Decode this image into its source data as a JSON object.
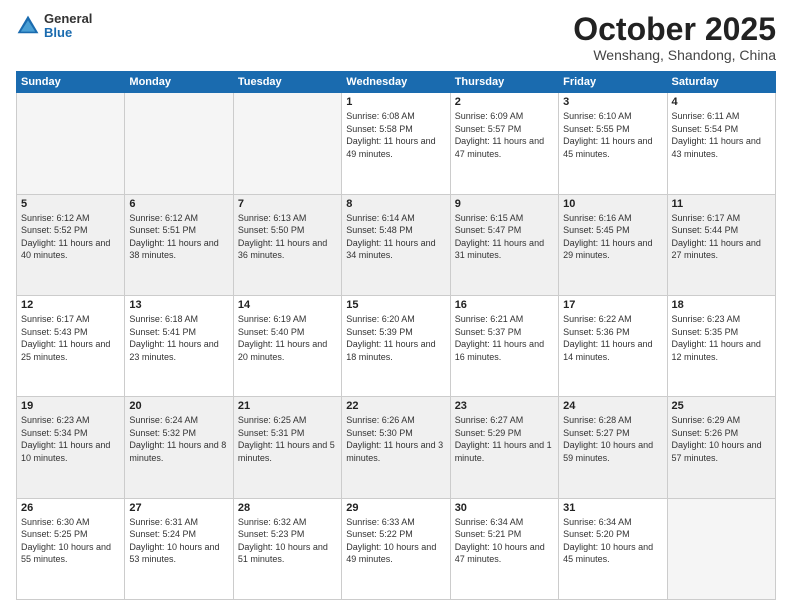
{
  "logo": {
    "general": "General",
    "blue": "Blue"
  },
  "header": {
    "month": "October 2025",
    "location": "Wenshang, Shandong, China"
  },
  "weekdays": [
    "Sunday",
    "Monday",
    "Tuesday",
    "Wednesday",
    "Thursday",
    "Friday",
    "Saturday"
  ],
  "weeks": [
    [
      {
        "day": "",
        "empty": true
      },
      {
        "day": "",
        "empty": true
      },
      {
        "day": "",
        "empty": true
      },
      {
        "day": "1",
        "sunrise": "6:08 AM",
        "sunset": "5:58 PM",
        "daylight": "11 hours and 49 minutes."
      },
      {
        "day": "2",
        "sunrise": "6:09 AM",
        "sunset": "5:57 PM",
        "daylight": "11 hours and 47 minutes."
      },
      {
        "day": "3",
        "sunrise": "6:10 AM",
        "sunset": "5:55 PM",
        "daylight": "11 hours and 45 minutes."
      },
      {
        "day": "4",
        "sunrise": "6:11 AM",
        "sunset": "5:54 PM",
        "daylight": "11 hours and 43 minutes."
      }
    ],
    [
      {
        "day": "5",
        "sunrise": "6:12 AM",
        "sunset": "5:52 PM",
        "daylight": "11 hours and 40 minutes."
      },
      {
        "day": "6",
        "sunrise": "6:12 AM",
        "sunset": "5:51 PM",
        "daylight": "11 hours and 38 minutes."
      },
      {
        "day": "7",
        "sunrise": "6:13 AM",
        "sunset": "5:50 PM",
        "daylight": "11 hours and 36 minutes."
      },
      {
        "day": "8",
        "sunrise": "6:14 AM",
        "sunset": "5:48 PM",
        "daylight": "11 hours and 34 minutes."
      },
      {
        "day": "9",
        "sunrise": "6:15 AM",
        "sunset": "5:47 PM",
        "daylight": "11 hours and 31 minutes."
      },
      {
        "day": "10",
        "sunrise": "6:16 AM",
        "sunset": "5:45 PM",
        "daylight": "11 hours and 29 minutes."
      },
      {
        "day": "11",
        "sunrise": "6:17 AM",
        "sunset": "5:44 PM",
        "daylight": "11 hours and 27 minutes."
      }
    ],
    [
      {
        "day": "12",
        "sunrise": "6:17 AM",
        "sunset": "5:43 PM",
        "daylight": "11 hours and 25 minutes."
      },
      {
        "day": "13",
        "sunrise": "6:18 AM",
        "sunset": "5:41 PM",
        "daylight": "11 hours and 23 minutes."
      },
      {
        "day": "14",
        "sunrise": "6:19 AM",
        "sunset": "5:40 PM",
        "daylight": "11 hours and 20 minutes."
      },
      {
        "day": "15",
        "sunrise": "6:20 AM",
        "sunset": "5:39 PM",
        "daylight": "11 hours and 18 minutes."
      },
      {
        "day": "16",
        "sunrise": "6:21 AM",
        "sunset": "5:37 PM",
        "daylight": "11 hours and 16 minutes."
      },
      {
        "day": "17",
        "sunrise": "6:22 AM",
        "sunset": "5:36 PM",
        "daylight": "11 hours and 14 minutes."
      },
      {
        "day": "18",
        "sunrise": "6:23 AM",
        "sunset": "5:35 PM",
        "daylight": "11 hours and 12 minutes."
      }
    ],
    [
      {
        "day": "19",
        "sunrise": "6:23 AM",
        "sunset": "5:34 PM",
        "daylight": "11 hours and 10 minutes."
      },
      {
        "day": "20",
        "sunrise": "6:24 AM",
        "sunset": "5:32 PM",
        "daylight": "11 hours and 8 minutes."
      },
      {
        "day": "21",
        "sunrise": "6:25 AM",
        "sunset": "5:31 PM",
        "daylight": "11 hours and 5 minutes."
      },
      {
        "day": "22",
        "sunrise": "6:26 AM",
        "sunset": "5:30 PM",
        "daylight": "11 hours and 3 minutes."
      },
      {
        "day": "23",
        "sunrise": "6:27 AM",
        "sunset": "5:29 PM",
        "daylight": "11 hours and 1 minute."
      },
      {
        "day": "24",
        "sunrise": "6:28 AM",
        "sunset": "5:27 PM",
        "daylight": "10 hours and 59 minutes."
      },
      {
        "day": "25",
        "sunrise": "6:29 AM",
        "sunset": "5:26 PM",
        "daylight": "10 hours and 57 minutes."
      }
    ],
    [
      {
        "day": "26",
        "sunrise": "6:30 AM",
        "sunset": "5:25 PM",
        "daylight": "10 hours and 55 minutes."
      },
      {
        "day": "27",
        "sunrise": "6:31 AM",
        "sunset": "5:24 PM",
        "daylight": "10 hours and 53 minutes."
      },
      {
        "day": "28",
        "sunrise": "6:32 AM",
        "sunset": "5:23 PM",
        "daylight": "10 hours and 51 minutes."
      },
      {
        "day": "29",
        "sunrise": "6:33 AM",
        "sunset": "5:22 PM",
        "daylight": "10 hours and 49 minutes."
      },
      {
        "day": "30",
        "sunrise": "6:34 AM",
        "sunset": "5:21 PM",
        "daylight": "10 hours and 47 minutes."
      },
      {
        "day": "31",
        "sunrise": "6:34 AM",
        "sunset": "5:20 PM",
        "daylight": "10 hours and 45 minutes."
      },
      {
        "day": "",
        "empty": true
      }
    ]
  ]
}
